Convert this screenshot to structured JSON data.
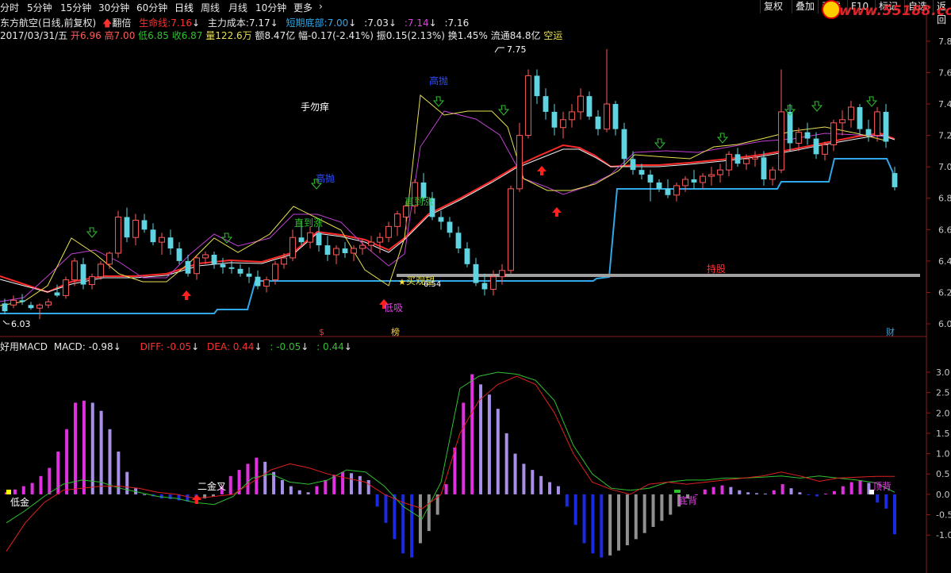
{
  "toolbar": {
    "timeframes": [
      "分时",
      "5分钟",
      "15分钟",
      "30分钟",
      "60分钟",
      "日线",
      "周线",
      "月线",
      "10分钟",
      "更多"
    ],
    "active": "日线",
    "more_arrow": "›",
    "buttons": [
      "复权",
      "叠加",
      "画线",
      "F10",
      "标记",
      "自选",
      "返回"
    ]
  },
  "watermark": {
    "text": "www.55188.com"
  },
  "header": {
    "stock": "东方航空(日线,前复权)",
    "flip_label": "翻倍",
    "lifeline_label": "生命线:",
    "lifeline_value": "7.16",
    "cost_label": "主力成本:",
    "cost_value": "7.17",
    "short_bottom_label": "短期底部:",
    "short_bottom_value": "7.00",
    "v1": ":7.03",
    "v2": ":7.14",
    "v3": ":7.16",
    "down_arrow": "↓"
  },
  "ohlc_line": {
    "date": "2017/03/31/五",
    "open": "开6.96",
    "high": "高7.00",
    "low": "低6.85",
    "close": "收6.87",
    "volume": "量122.6万",
    "amount": "额8.47亿",
    "change": "幅-0.17(-2.41%)",
    "amplitude": "振0.15(2.13%)",
    "turnover": "换1.45%",
    "float": "流通84.8亿",
    "status": "空运"
  },
  "macd_header": {
    "title": "好用MACD",
    "macd": "MACD: -0.98",
    "diff": "DIFF: -0.05",
    "dea": "DEA: 0.44",
    "v1": ": -0.05",
    "v2": ": 0.44",
    "down_arrow": "↓"
  },
  "colors": {
    "bg": "#000000",
    "up_candle": "#ff5a5a",
    "down_candle": "#5fd4e0",
    "ma_red": "#ff2a2a",
    "ma_white": "#f0f0f0",
    "ma_purple": "#c040d0",
    "ma_yellow": "#e8e050",
    "step_line": "#30a8e8",
    "grey_line": "#a0a0a0",
    "macd_pos": "#e030e0",
    "macd_pos_light": "#a890e8",
    "macd_neg": "#1a2ae0",
    "macd_neg_light": "#909090",
    "diff_line": "#30c030",
    "dea_line": "#e02020"
  },
  "chart_data": [
    {
      "type": "candlestick",
      "title": "东方航空(日线,前复权)",
      "y_ticks": [
        "7.8",
        "7.6",
        "7.4",
        "7.2",
        "7.0",
        "6.8",
        "6.6",
        "6.4",
        "6.2",
        "6.0"
      ],
      "ylim": [
        5.98,
        7.86
      ],
      "ohlc": [
        [
          6.13,
          6.16,
          6.06,
          6.08
        ],
        [
          6.12,
          6.18,
          6.1,
          6.15
        ],
        [
          6.15,
          6.19,
          6.12,
          6.14
        ],
        [
          6.12,
          6.14,
          6.09,
          6.1
        ],
        [
          6.1,
          6.13,
          6.03,
          6.12
        ],
        [
          6.12,
          6.16,
          6.1,
          6.14
        ],
        [
          6.2,
          6.25,
          6.17,
          6.18
        ],
        [
          6.18,
          6.3,
          6.16,
          6.28
        ],
        [
          6.28,
          6.42,
          6.24,
          6.4
        ],
        [
          6.38,
          6.42,
          6.22,
          6.25
        ],
        [
          6.25,
          6.32,
          6.22,
          6.3
        ],
        [
          6.3,
          6.4,
          6.28,
          6.38
        ],
        [
          6.38,
          6.46,
          6.35,
          6.45
        ],
        [
          6.45,
          6.72,
          6.42,
          6.68
        ],
        [
          6.68,
          6.74,
          6.52,
          6.55
        ],
        [
          6.55,
          6.7,
          6.5,
          6.66
        ],
        [
          6.66,
          6.7,
          6.58,
          6.6
        ],
        [
          6.6,
          6.64,
          6.5,
          6.52
        ],
        [
          6.52,
          6.58,
          6.44,
          6.55
        ],
        [
          6.55,
          6.6,
          6.44,
          6.48
        ],
        [
          6.48,
          6.52,
          6.38,
          6.4
        ],
        [
          6.4,
          6.44,
          6.3,
          6.32
        ],
        [
          6.32,
          6.44,
          6.28,
          6.42
        ],
        [
          6.42,
          6.46,
          6.38,
          6.44
        ],
        [
          6.44,
          6.46,
          6.35,
          6.38
        ],
        [
          6.38,
          6.42,
          6.32,
          6.36
        ],
        [
          6.36,
          6.4,
          6.32,
          6.35
        ],
        [
          6.35,
          6.38,
          6.3,
          6.32
        ],
        [
          6.32,
          6.36,
          6.26,
          6.3
        ],
        [
          6.3,
          6.34,
          6.22,
          6.24
        ],
        [
          6.24,
          6.3,
          6.2,
          6.28
        ],
        [
          6.28,
          6.4,
          6.25,
          6.38
        ],
        [
          6.38,
          6.45,
          6.35,
          6.42
        ],
        [
          6.42,
          6.6,
          6.4,
          6.55
        ],
        [
          6.55,
          6.66,
          6.5,
          6.52
        ],
        [
          6.52,
          6.62,
          6.48,
          6.58
        ],
        [
          6.58,
          6.62,
          6.46,
          6.5
        ],
        [
          6.5,
          6.56,
          6.4,
          6.44
        ],
        [
          6.44,
          6.5,
          6.38,
          6.48
        ],
        [
          6.48,
          6.52,
          6.42,
          6.45
        ],
        [
          6.45,
          6.5,
          6.4,
          6.48
        ],
        [
          6.48,
          6.54,
          6.44,
          6.5
        ],
        [
          6.5,
          6.56,
          6.46,
          6.52
        ],
        [
          6.52,
          6.58,
          6.45,
          6.55
        ],
        [
          6.55,
          6.65,
          6.52,
          6.62
        ],
        [
          6.62,
          6.72,
          6.56,
          6.7
        ],
        [
          6.68,
          6.78,
          6.6,
          6.75
        ],
        [
          6.75,
          6.92,
          6.7,
          6.9
        ],
        [
          6.9,
          6.96,
          6.78,
          6.8
        ],
        [
          6.8,
          6.84,
          6.66,
          6.68
        ],
        [
          6.68,
          6.72,
          6.6,
          6.65
        ],
        [
          6.65,
          6.68,
          6.55,
          6.58
        ],
        [
          6.58,
          6.62,
          6.45,
          6.48
        ],
        [
          6.48,
          6.52,
          6.36,
          6.38
        ],
        [
          6.38,
          6.42,
          6.24,
          6.26
        ],
        [
          6.26,
          6.32,
          6.18,
          6.22
        ],
        [
          6.22,
          6.34,
          6.18,
          6.3
        ],
        [
          6.3,
          6.38,
          6.25,
          6.34
        ],
        [
          6.34,
          6.88,
          6.32,
          6.86
        ],
        [
          6.86,
          7.28,
          6.84,
          7.2
        ],
        [
          7.2,
          7.62,
          7.18,
          7.58
        ],
        [
          7.58,
          7.62,
          7.4,
          7.45
        ],
        [
          7.45,
          7.5,
          7.3,
          7.35
        ],
        [
          7.35,
          7.4,
          7.2,
          7.25
        ],
        [
          7.25,
          7.35,
          7.18,
          7.3
        ],
        [
          7.3,
          7.4,
          7.25,
          7.35
        ],
        [
          7.35,
          7.5,
          7.3,
          7.45
        ],
        [
          7.45,
          7.48,
          7.3,
          7.32
        ],
        [
          7.32,
          7.36,
          7.2,
          7.24
        ],
        [
          7.24,
          7.75,
          7.22,
          7.4
        ],
        [
          7.4,
          7.42,
          7.2,
          7.24
        ],
        [
          7.24,
          7.28,
          7.0,
          7.05
        ],
        [
          7.05,
          7.1,
          6.95,
          6.98
        ],
        [
          6.98,
          7.02,
          6.92,
          6.95
        ],
        [
          6.95,
          6.98,
          6.78,
          6.9
        ],
        [
          6.9,
          6.92,
          6.84,
          6.86
        ],
        [
          6.86,
          6.92,
          6.8,
          6.82
        ],
        [
          6.82,
          6.9,
          6.78,
          6.88
        ],
        [
          6.88,
          6.94,
          6.84,
          6.92
        ],
        [
          6.92,
          6.98,
          6.86,
          6.9
        ],
        [
          6.9,
          6.96,
          6.86,
          6.94
        ],
        [
          6.94,
          7.0,
          6.88,
          6.95
        ],
        [
          6.95,
          7.02,
          6.9,
          6.98
        ],
        [
          6.98,
          7.1,
          6.94,
          7.08
        ],
        [
          7.08,
          7.12,
          7.0,
          7.02
        ],
        [
          7.02,
          7.08,
          6.98,
          7.05
        ],
        [
          7.05,
          7.1,
          7.0,
          7.06
        ],
        [
          7.06,
          7.1,
          6.88,
          6.92
        ],
        [
          6.92,
          7.0,
          6.88,
          6.98
        ],
        [
          6.98,
          7.62,
          6.96,
          7.35
        ],
        [
          7.35,
          7.4,
          7.1,
          7.15
        ],
        [
          7.15,
          7.25,
          7.1,
          7.22
        ],
        [
          7.22,
          7.28,
          7.14,
          7.18
        ],
        [
          7.18,
          7.22,
          7.05,
          7.08
        ],
        [
          7.08,
          7.16,
          7.04,
          7.14
        ],
        [
          7.14,
          7.3,
          7.1,
          7.28
        ],
        [
          7.28,
          7.36,
          7.2,
          7.3
        ],
        [
          7.3,
          7.42,
          7.25,
          7.38
        ],
        [
          7.38,
          7.4,
          7.2,
          7.24
        ],
        [
          7.24,
          7.3,
          7.16,
          7.2
        ],
        [
          7.2,
          7.38,
          7.16,
          7.35
        ],
        [
          7.35,
          7.4,
          7.12,
          7.16
        ],
        [
          6.96,
          7.0,
          6.85,
          6.87
        ]
      ],
      "candle_count": 103,
      "annotations": [
        "手勿痒",
        "高抛",
        "直到涨",
        "低吸",
        "买观望",
        "持股",
        "7.75",
        "6.03",
        "6.54",
        "$",
        "榜",
        "财"
      ]
    },
    {
      "type": "bar",
      "title": "好用MACD",
      "y_ticks": [
        "3.0",
        "2.5",
        "2.0",
        "1.5",
        "1.0",
        "0.5",
        "0.0",
        "-0.5",
        "-1.0"
      ],
      "ylim": [
        -1.6,
        3.35
      ],
      "series": [
        {
          "name": "MACD",
          "values": [
            0.05,
            0.12,
            0.2,
            0.28,
            0.45,
            0.65,
            1.05,
            1.6,
            2.25,
            2.3,
            2.25,
            2.05,
            1.6,
            1.05,
            0.55,
            0.15,
            0.0,
            -0.05,
            -0.1,
            -0.12,
            -0.15,
            -0.18,
            -0.2,
            -0.1,
            -0.05,
            0.2,
            0.45,
            0.6,
            0.75,
            0.9,
            0.8,
            0.55,
            0.35,
            0.2,
            0.1,
            0.05,
            0.2,
            0.35,
            0.48,
            0.55,
            0.52,
            0.45,
            0.35,
            -0.3,
            -0.7,
            -1.1,
            -1.45,
            -1.55,
            -1.2,
            -0.9,
            -0.5,
            0.25,
            1.15,
            2.25,
            2.95,
            2.7,
            2.45,
            2.1,
            1.5,
            1.0,
            0.75,
            0.6,
            0.45,
            0.3,
            0.2,
            -0.3,
            -0.75,
            -1.2,
            -1.45,
            -1.55,
            -1.5,
            -1.38,
            -1.25,
            -1.1,
            -0.95,
            -0.8,
            -0.65,
            -0.5,
            -0.3,
            -0.1,
            0.0,
            0.12,
            0.18,
            0.22,
            0.18,
            0.1,
            0.05,
            0.03,
            0.02,
            0.1,
            0.25,
            0.15,
            0.05,
            -0.02,
            -0.05,
            0.02,
            0.08,
            0.2,
            0.3,
            0.35,
            0.28,
            -0.2,
            -0.35,
            -0.98
          ]
        },
        {
          "name": "DIFF",
          "values": [
            -0.7,
            -0.4,
            -0.05,
            0.25,
            0.35,
            0.3,
            0.15,
            0.05,
            -0.05,
            -0.1,
            -0.2,
            -0.25,
            -0.05,
            0.4,
            0.5,
            0.3,
            0.25,
            0.35,
            0.6,
            0.55,
            0.2,
            -0.3,
            -0.6,
            0.3,
            2.6,
            2.9,
            3.0,
            2.95,
            2.8,
            2.3,
            1.2,
            0.5,
            0.15,
            0.1,
            0.15,
            0.3,
            0.35,
            0.35,
            0.4,
            0.4,
            0.42,
            0.45,
            0.4,
            0.45,
            0.4,
            0.35,
            0.28,
            0.05
          ]
        },
        {
          "name": "DEA",
          "values": [
            -1.4,
            -0.7,
            -0.2,
            0.1,
            0.15,
            0.2,
            0.2,
            0.15,
            0.05,
            0.0,
            -0.1,
            -0.05,
            0.0,
            0.3,
            0.6,
            0.75,
            0.65,
            0.5,
            0.4,
            0.3,
            0.0,
            -0.2,
            -0.35,
            0.0,
            1.5,
            2.3,
            2.7,
            2.9,
            2.7,
            2.0,
            1.0,
            0.3,
            0.12,
            0.0,
            0.25,
            0.3,
            0.25,
            0.3,
            0.35,
            0.4,
            0.45,
            0.55,
            0.45,
            0.32,
            0.4,
            0.42,
            0.44,
            0.44
          ]
        }
      ],
      "annotations": [
        "低金",
        "二金叉",
        "底背",
        "顶背"
      ]
    }
  ]
}
